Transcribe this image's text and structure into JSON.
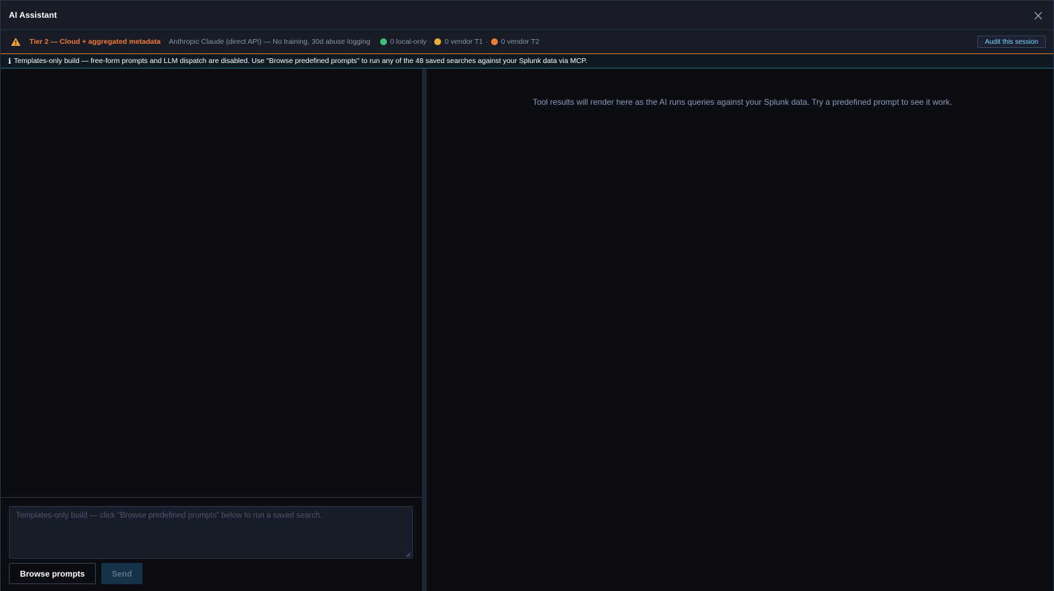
{
  "window": {
    "title": "AI Assistant",
    "close_icon": "close-icon"
  },
  "tier_bar": {
    "warning_icon": "warning-triangle-icon",
    "tier_label": "Tier 2 — Cloud + aggregated metadata",
    "provider": "Anthropic Claude (direct API) — No training, 30d abuse logging",
    "counts": [
      {
        "color": "#3ec27a",
        "label": "0 local-only"
      },
      {
        "color": "#e8b23a",
        "label": "0 vendor T1"
      },
      {
        "color": "#f07a3a",
        "label": "0 vendor T2"
      }
    ],
    "separator": "·",
    "audit_label": "Audit this session",
    "tier_color": "#f07a3a"
  },
  "info_bar": {
    "icon": "info-icon",
    "icon_glyph": "ℹ",
    "text": "Templates-only build — free-form prompts and LLM dispatch are disabled. Use \"Browse predefined prompts\" to run any of the 48 saved searches against your Splunk data via MCP."
  },
  "results_panel": {
    "empty_message": "Tool results will render here as the AI runs queries against your Splunk data. Try a predefined prompt to see it work."
  },
  "composer": {
    "placeholder": "Templates-only build — click \"Browse predefined prompts\" below to run a saved search.",
    "value": "",
    "browse_label": "Browse prompts",
    "send_label": "Send"
  }
}
